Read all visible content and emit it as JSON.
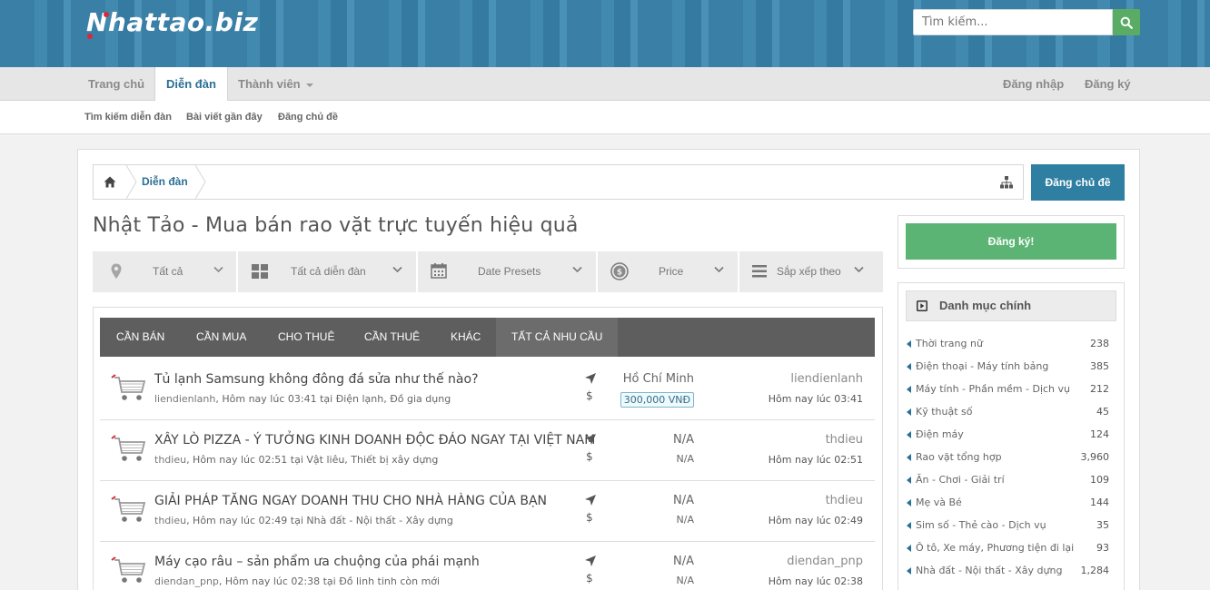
{
  "header": {
    "logo_text": "Nhattao.biz",
    "search_placeholder": "Tìm kiếm..."
  },
  "nav": {
    "items": [
      {
        "label": "Trang chủ"
      },
      {
        "label": "Diễn đàn"
      },
      {
        "label": "Thành viên"
      }
    ],
    "right": [
      {
        "label": "Đăng nhập"
      },
      {
        "label": "Đăng ký"
      }
    ]
  },
  "subnav": {
    "items": [
      {
        "label": "Tìm kiếm diễn đàn"
      },
      {
        "label": "Bài viết gần đây"
      },
      {
        "label": "Đăng chủ đề"
      }
    ]
  },
  "breadcrumb": {
    "label": "Diễn đàn"
  },
  "post_button": "Đăng chủ đề",
  "page_title": "Nhật Tảo - Mua bán rao vặt trực tuyến hiệu quả",
  "filters": [
    {
      "label": "Tất cả",
      "icon": "map-marker-icon"
    },
    {
      "label": "Tất cả diễn đàn",
      "icon": "grid-icon"
    },
    {
      "label": "Date Presets",
      "icon": "calendar-icon"
    },
    {
      "label": "Price",
      "icon": "coin-icon"
    },
    {
      "label": "Sắp xếp theo",
      "icon": "list-icon"
    }
  ],
  "tabs": [
    {
      "label": "CẦN BÁN"
    },
    {
      "label": "CẦN MUA"
    },
    {
      "label": "CHO THUÊ"
    },
    {
      "label": "CẦN THUÊ"
    },
    {
      "label": "KHÁC"
    },
    {
      "label": "TẤT CẢ NHU CẦU"
    }
  ],
  "threads": [
    {
      "title": "Tủ lạnh Samsung không đông đá sửa như thế nào?",
      "user": "liendienlanh",
      "meta_time": ", Hôm nay lúc 03:41",
      "meta_tai": " tại ",
      "forum": "Điện lạnh, Đồ gia dụng",
      "location": "Hồ Chí Minh",
      "price": "300,000 VNĐ",
      "last_user": "liendienlanh",
      "last_time": "Hôm nay lúc 03:41"
    },
    {
      "title": "XÂY LÒ PIZZA - Ý TƯỞNG KINH DOANH ĐỘC ĐÁO NGAY TẠI VIỆT NAM",
      "user": "thdieu",
      "meta_time": ", Hôm nay lúc 02:51",
      "meta_tai": " tại ",
      "forum": "Vật liêu, Thiết bị xây dựng",
      "location": "N/A",
      "price": "N/A",
      "last_user": "thdieu",
      "last_time": "Hôm nay lúc 02:51"
    },
    {
      "title": "GIẢI PHÁP TĂNG NGAY DOANH THU CHO NHÀ HÀNG CỦA BẠN",
      "user": "thdieu",
      "meta_time": ", Hôm nay lúc 02:49",
      "meta_tai": " tại ",
      "forum": "Nhà đất - Nội thất - Xây dựng",
      "location": "N/A",
      "price": "N/A",
      "last_user": "thdieu",
      "last_time": "Hôm nay lúc 02:49"
    },
    {
      "title": "Máy cạo râu – sản phẩm ưa chuộng của phái mạnh",
      "user": "diendan_pnp",
      "meta_time": ", Hôm nay lúc 02:38",
      "meta_tai": " tại ",
      "forum": "Đồ linh tinh còn mới",
      "location": "N/A",
      "price": "N/A",
      "last_user": "diendan_pnp",
      "last_time": "Hôm nay lúc 02:38"
    }
  ],
  "sidebar": {
    "register_label": "Đăng ký!",
    "categories_title": "Danh mục chính",
    "categories": [
      {
        "label": "Thời trang nữ",
        "count": "238"
      },
      {
        "label": "Điện thoại - Máy tính bảng",
        "count": "385"
      },
      {
        "label": "Máy tính - Phần mềm - Dịch vụ",
        "count": "212"
      },
      {
        "label": "Kỹ thuật số",
        "count": "45"
      },
      {
        "label": "Điện máy",
        "count": "124"
      },
      {
        "label": "Rao vặt tổng hợp",
        "count": "3,960"
      },
      {
        "label": "Ăn - Chơi - Giải trí",
        "count": "109"
      },
      {
        "label": "Mẹ và Bé",
        "count": "144"
      },
      {
        "label": "Sim số - Thẻ cào - Dịch vụ",
        "count": "35"
      },
      {
        "label": "Ô tô, Xe máy, Phương tiện đi lại",
        "count": "93"
      },
      {
        "label": "Nhà đất - Nội thất - Xây dựng",
        "count": "1,284"
      }
    ]
  },
  "colors": {
    "header_blue": "#3c82a9",
    "link_blue": "#2a6f96",
    "post_button": "#2f7fa3",
    "register_green": "#5cb474",
    "search_green": "#5aac65",
    "tabs_bg": "#5e5e5e"
  }
}
